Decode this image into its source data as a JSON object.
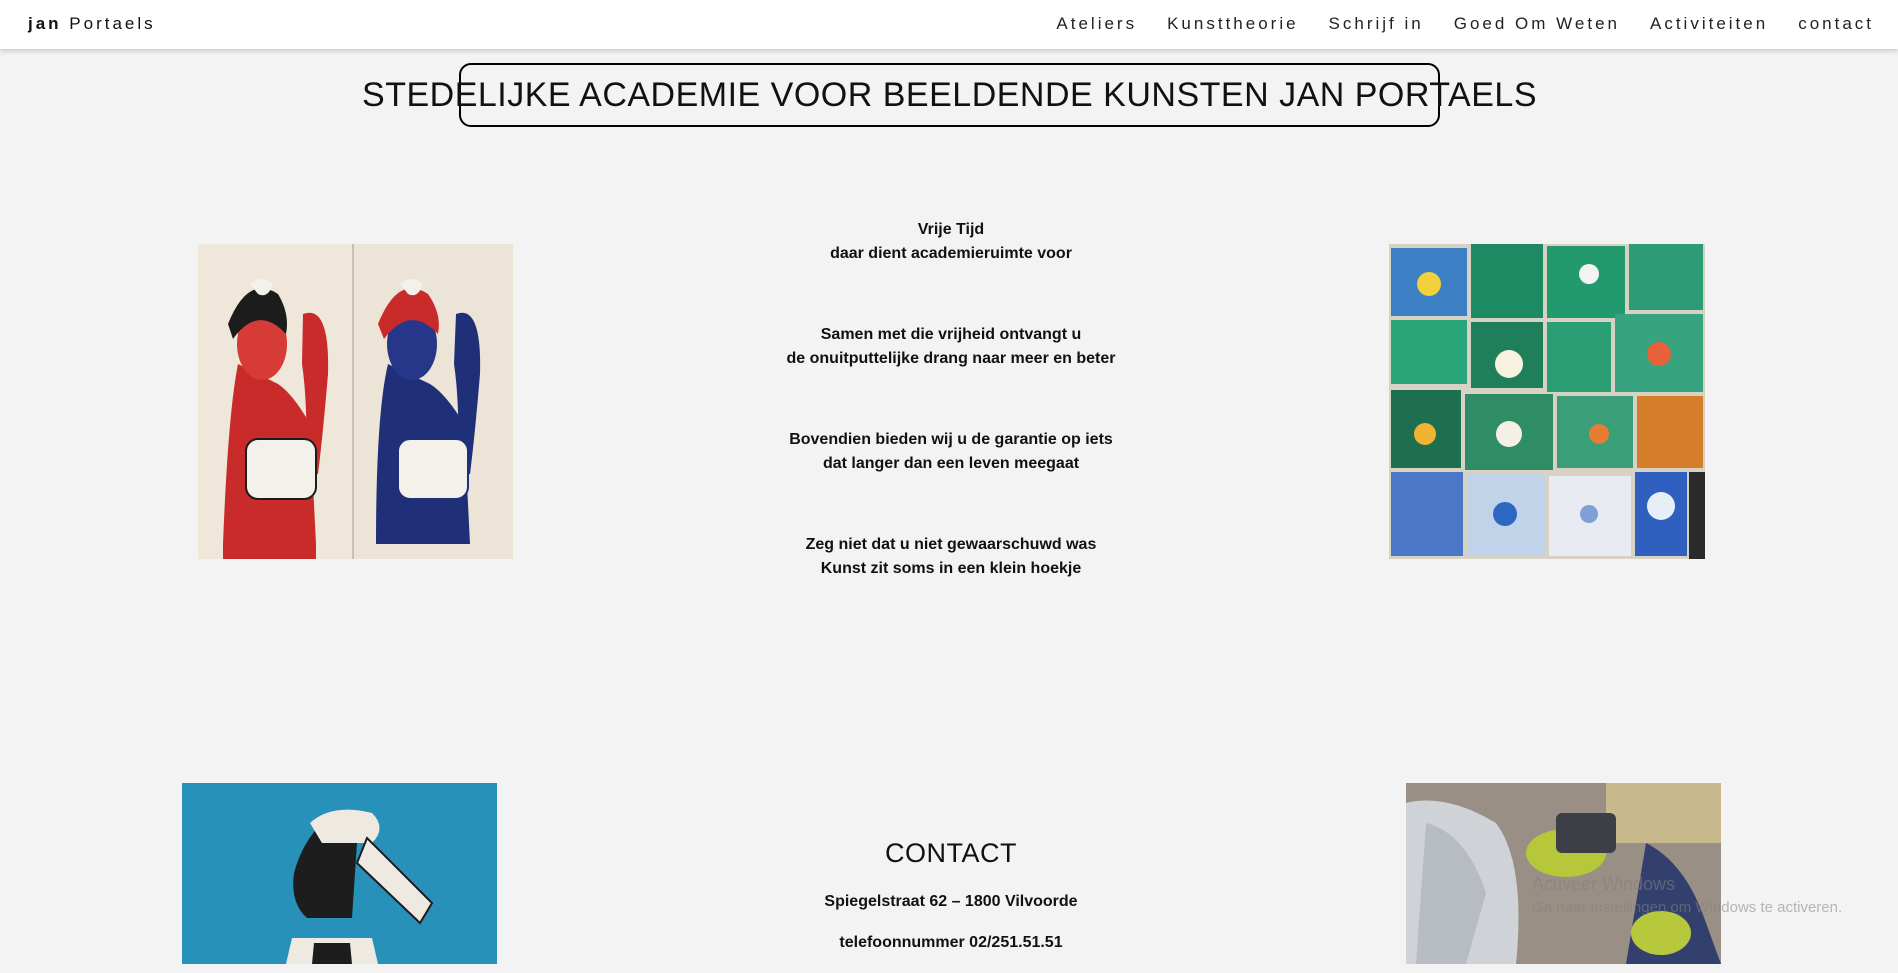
{
  "header": {
    "brand_bold": "jan",
    "brand_rest": " Portaels",
    "nav": [
      "Ateliers",
      "Kunsttheorie",
      "Schrijf in",
      "Goed Om Weten",
      "Activiteiten",
      "contact"
    ]
  },
  "main": {
    "title": "STEDELIJKE ACADEMIE VOOR BEELDENDE KUNSTEN JAN PORTAELS",
    "stanzas": [
      [
        "Vrije Tijd",
        "daar dient academieruimte voor"
      ],
      [
        "Samen met die vrijheid ontvangt u",
        "de onuitputtelijke drang naar meer en beter"
      ],
      [
        "Bovendien bieden wij u de garantie op iets",
        "dat langer dan een leven meegaat"
      ],
      [
        "Zeg niet dat u niet gewaarschuwd was",
        "Kunst zit soms in een klein hoekje"
      ]
    ]
  },
  "contact": {
    "heading": "CONTACT",
    "address": "Spiegelstraat 62 – 1800 Vilvoorde",
    "phone": "telefoonnummer 02/251.51.51"
  },
  "watermark": {
    "line1": "Activeer Windows",
    "line2": "Ga naar Instellingen om Windows te activeren."
  },
  "colors": {
    "background": "#f3f3f3",
    "header_bg": "#ffffff",
    "text": "#111111"
  }
}
